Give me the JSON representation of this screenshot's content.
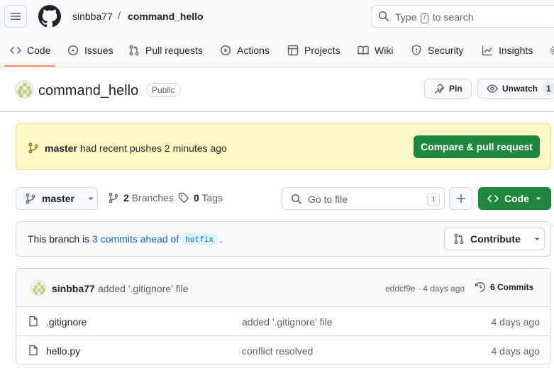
{
  "header": {
    "owner": "sinbba77",
    "separator": "/",
    "repo": "command_hello",
    "search": {
      "prefix": "Type",
      "key": "/",
      "suffix": "to search"
    }
  },
  "nav": {
    "tabs": [
      {
        "label": "Code",
        "icon": "code-icon",
        "active": true
      },
      {
        "label": "Issues",
        "icon": "issue-icon"
      },
      {
        "label": "Pull requests",
        "icon": "pull-request-icon"
      },
      {
        "label": "Actions",
        "icon": "play-icon"
      },
      {
        "label": "Projects",
        "icon": "table-icon"
      },
      {
        "label": "Wiki",
        "icon": "book-icon"
      },
      {
        "label": "Security",
        "icon": "shield-icon"
      },
      {
        "label": "Insights",
        "icon": "graph-icon"
      }
    ]
  },
  "repo": {
    "name": "command_hello",
    "visibility": "Public",
    "pin_label": "Pin",
    "watch_label": "Unwatch",
    "watch_count": "1"
  },
  "banner": {
    "branch": "master",
    "message": "had recent pushes 2 minutes ago",
    "button": "Compare & pull request"
  },
  "toolbar": {
    "branch": "master",
    "branches_count": "2",
    "branches_label": "Branches",
    "tags_count": "0",
    "tags_label": "Tags",
    "goto_placeholder": "Go to file",
    "goto_key": "t",
    "code_button": "Code"
  },
  "ahead": {
    "prefix": "This branch is",
    "link": "3 commits ahead of",
    "target": "hotfix",
    "suffix": ".",
    "contribute": "Contribute"
  },
  "commit": {
    "author": "sinbba77",
    "message": "added '.gitignore' file",
    "hash_time": "eddcf9e · 4 days ago",
    "commits_label": "6 Commits"
  },
  "files": [
    {
      "name": ".gitignore",
      "message": "added '.gitignore' file",
      "date": "4 days ago"
    },
    {
      "name": "hello.py",
      "message": "conflict resolved",
      "date": "4 days ago"
    }
  ],
  "colors": {
    "accent_green": "#1f883d",
    "link_blue": "#0969da",
    "tab_underline": "#fd8c73",
    "banner_bg": "#fff8c5"
  }
}
